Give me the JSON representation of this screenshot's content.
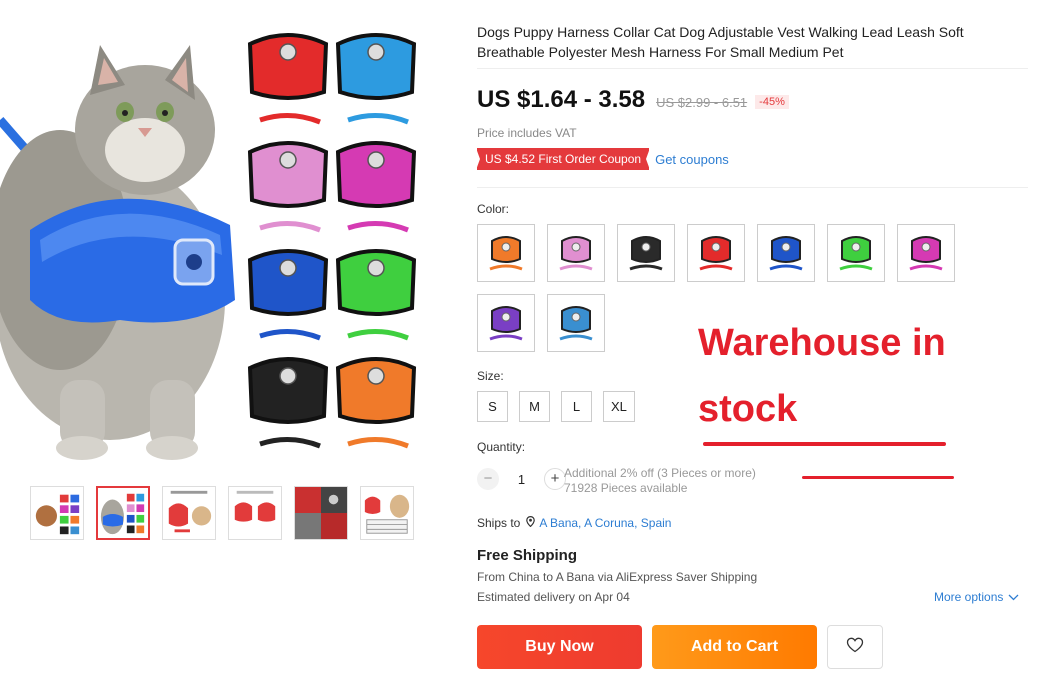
{
  "product": {
    "title": "Dogs Puppy Harness Collar Cat Dog Adjustable Vest Walking Lead Leash Soft Breathable Polyester Mesh Harness For Small Medium Pet",
    "price": "US $1.64 - 3.58",
    "old_price": "US $2.99 - 6.51",
    "discount": "-45%",
    "vat_note": "Price includes VAT",
    "coupon": "US $4.52 First Order Coupon",
    "get_coupons": "Get coupons"
  },
  "color": {
    "label": "Color:",
    "swatches": [
      {
        "color": "#f07a2a"
      },
      {
        "color": "#e08fd0"
      },
      {
        "color": "#2a2a2a"
      },
      {
        "color": "#e32b2b"
      },
      {
        "color": "#1f55c9"
      },
      {
        "color": "#3fcf3f"
      },
      {
        "color": "#d53ab3"
      },
      {
        "color": "#7a3fc4"
      },
      {
        "color": "#3a8fd0"
      }
    ]
  },
  "size": {
    "label": "Size:",
    "options": [
      "S",
      "M",
      "L",
      "XL"
    ]
  },
  "quantity": {
    "label": "Quantity:",
    "minus": "−",
    "plus": "+",
    "value": "1",
    "note1": "Additional 2% off (3 Pieces or more)",
    "note2": "71928 Pieces available"
  },
  "shipping": {
    "ships_to_label": "Ships to",
    "location": "A Bana, A Coruna, Spain",
    "free": "Free Shipping",
    "from": "From China to A Bana via AliExpress Saver Shipping",
    "eta": "Estimated delivery on Apr 04",
    "more_options": "More options"
  },
  "actions": {
    "buy_now": "Buy Now",
    "add_to_cart": "Add to Cart"
  },
  "annotation": {
    "line1": "Warehouse in",
    "line2": "stock",
    "color": "#e4202c"
  },
  "gallery": {
    "active_thumb": 2,
    "thumb_count": 6
  },
  "icons": {
    "location": "pin-icon",
    "chevron": "chevron-down-icon",
    "wishlist": "heart-icon"
  }
}
